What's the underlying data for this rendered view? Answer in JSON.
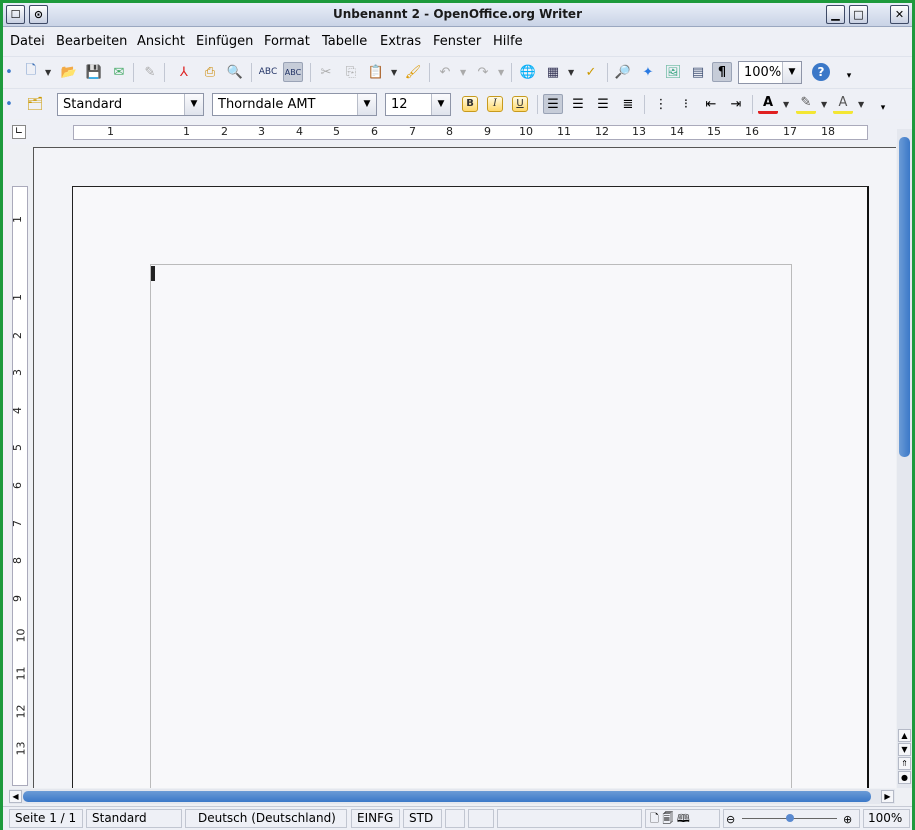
{
  "window": {
    "title": "Unbenannt 2 - OpenOffice.org Writer"
  },
  "menu": [
    "Datei",
    "Bearbeiten",
    "Ansicht",
    "Einfügen",
    "Format",
    "Tabelle",
    "Extras",
    "Fenster",
    "Hilfe"
  ],
  "standard_toolbar": {
    "zoom": "100%"
  },
  "format_toolbar": {
    "style": "Standard",
    "font": "Thorndale AMT",
    "size": "12",
    "bold": "B",
    "italic": "I",
    "underline": "U"
  },
  "hruler": [
    "1",
    "1",
    "2",
    "3",
    "4",
    "5",
    "6",
    "7",
    "8",
    "9",
    "10",
    "11",
    "12",
    "13",
    "14",
    "15",
    "16",
    "17",
    "18"
  ],
  "vruler": [
    "1",
    "1",
    "2",
    "3",
    "4",
    "5",
    "6",
    "7",
    "8",
    "9",
    "10",
    "11",
    "12",
    "13"
  ],
  "status": {
    "page": "Seite 1 / 1",
    "style": "Standard",
    "language": "Deutsch (Deutschland)",
    "insert": "EINFG",
    "selection": "STD",
    "zoom": "100%"
  },
  "icons": [
    "new-icon",
    "open-icon",
    "save-icon",
    "email-icon",
    "pdf-icon",
    "print-icon",
    "preview-icon",
    "spellcheck-icon",
    "autospell-icon",
    "cut-icon",
    "copy-icon",
    "paste-icon",
    "format-paintbrush-icon",
    "undo-icon",
    "redo-icon",
    "hyperlink-icon",
    "table-icon",
    "draw-icon",
    "find-icon",
    "navigator-icon",
    "gallery-icon",
    "datasource-icon",
    "nonprinting-chars-icon",
    "help-icon"
  ],
  "colors": {
    "accent": "#3b78c8",
    "window_border": "#1d9a3c"
  }
}
